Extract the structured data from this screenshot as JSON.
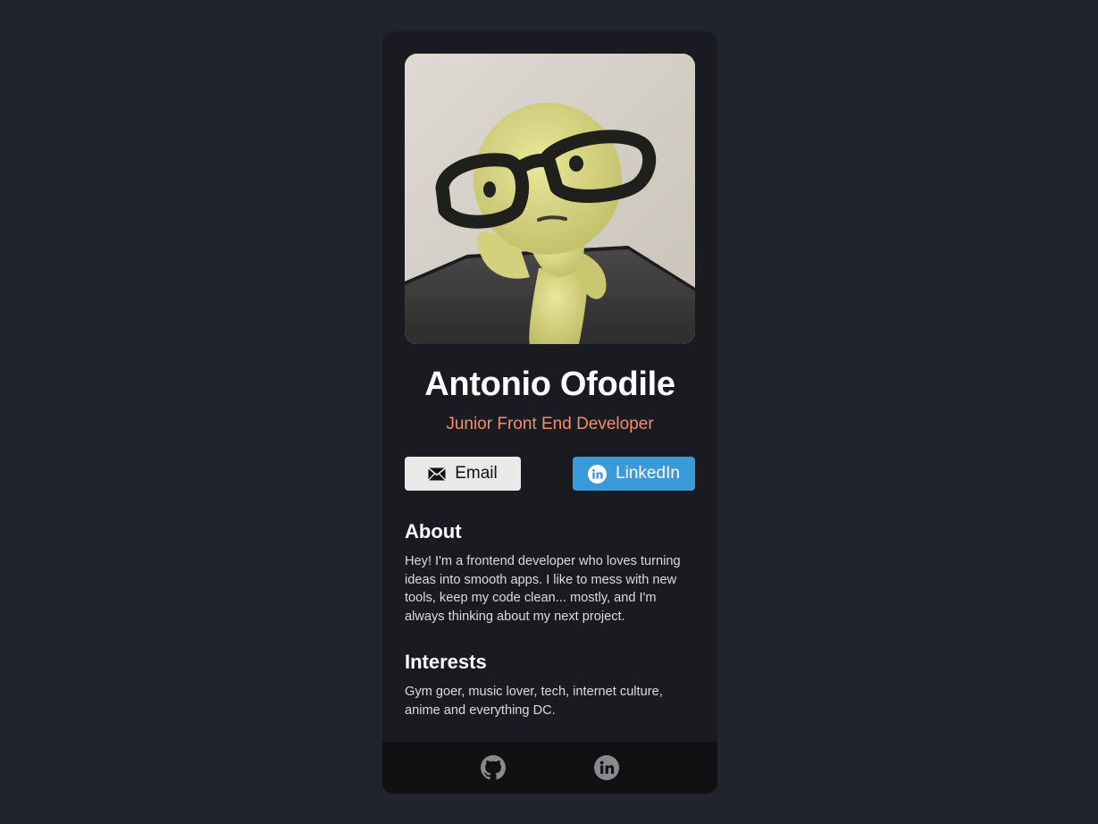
{
  "profile": {
    "name": "Antonio Ofodile",
    "role": "Junior Front End Developer",
    "photo_icon": "profile-photo"
  },
  "buttons": {
    "email": {
      "label": "Email",
      "icon": "envelope-icon"
    },
    "linkedin": {
      "label": "LinkedIn",
      "icon": "linkedin-icon"
    }
  },
  "about": {
    "title": "About",
    "text": "Hey! I'm a frontend developer who loves turning ideas into smooth apps. I like to mess with new tools, keep my code clean... mostly, and I'm always thinking about my next project."
  },
  "interests": {
    "title": "Interests",
    "text": "Gym goer, music lover, tech, internet culture, anime and everything DC."
  },
  "footer": {
    "icons": [
      "github-icon",
      "linkedin-icon"
    ]
  },
  "colors": {
    "page_background": "#22242d",
    "card_background": "#1a1b20",
    "footer_background": "#111113",
    "accent_role": "#f0906a",
    "linkedin_button": "#3b9ad9",
    "email_button": "#e9e9e9"
  }
}
